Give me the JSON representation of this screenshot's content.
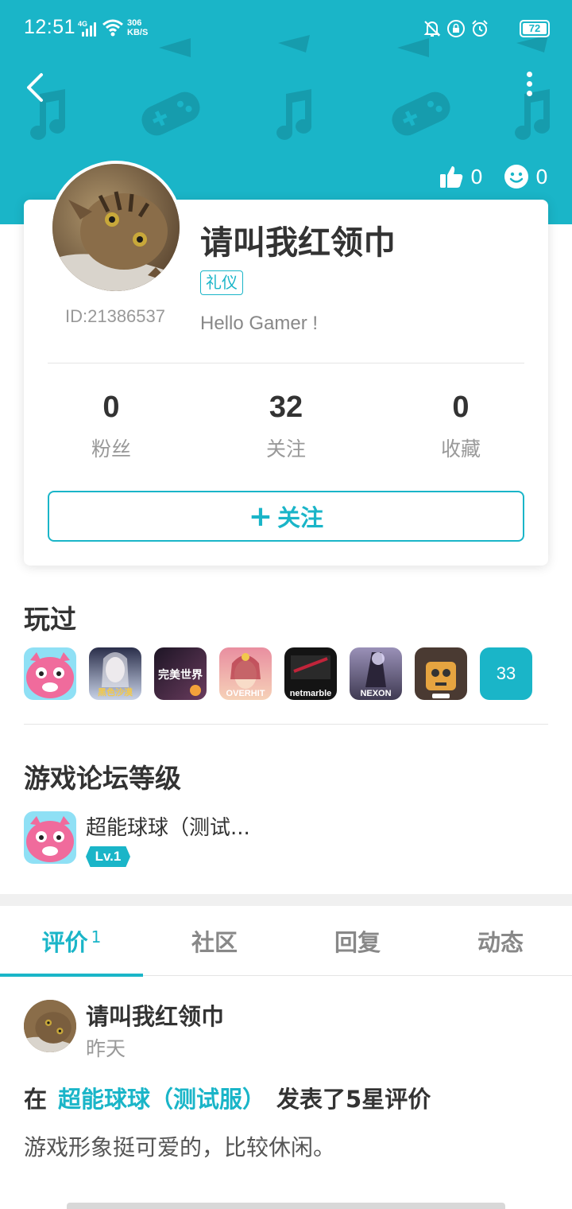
{
  "status_bar": {
    "time": "12:51",
    "network": "4G",
    "speed_value": "306",
    "speed_unit": "KB/S",
    "battery": "72"
  },
  "colors": {
    "accent": "#1ab5c8",
    "text": "#333333",
    "muted": "#999999"
  },
  "header": {
    "likes": "0",
    "smiles": "0"
  },
  "profile": {
    "username": "请叫我红领巾",
    "id_text": "ID:21386537",
    "badge": "礼仪",
    "bio": "Hello Gamer !",
    "stats": [
      {
        "value": "0",
        "label": "粉丝"
      },
      {
        "value": "32",
        "label": "关注"
      },
      {
        "value": "0",
        "label": "收藏"
      }
    ],
    "follow_label": "关注"
  },
  "played": {
    "title": "玩过",
    "games": [
      {
        "label": "",
        "color_a": "#f06b9c",
        "color_b": "#8fe0f5"
      },
      {
        "label": "黑色沙漠",
        "color_a": "#2a2e4a",
        "color_b": "#c9d3e8"
      },
      {
        "label": "完美世界",
        "color_a": "#1d1525",
        "color_b": "#6a3c5e"
      },
      {
        "label": "OVERHIT",
        "color_a": "#e98ea0",
        "color_b": "#f6d2b8"
      },
      {
        "label": "netmarble",
        "color_a": "#141414",
        "color_b": "#3a3a3a"
      },
      {
        "label": "NEXON",
        "color_a": "#3f3a52",
        "color_b": "#9a91b8"
      },
      {
        "label": "",
        "color_a": "#4a3a32",
        "color_b": "#e6a440"
      }
    ],
    "more_count": "33"
  },
  "forum": {
    "title": "游戏论坛等级",
    "game_name": "超能球球（测试...",
    "level": "Lv.1"
  },
  "tabs": [
    {
      "label": "评价",
      "count": "1"
    },
    {
      "label": "社区",
      "count": ""
    },
    {
      "label": "回复",
      "count": ""
    },
    {
      "label": "动态",
      "count": ""
    }
  ],
  "review": {
    "username": "请叫我红领巾",
    "time": "昨天",
    "prefix": "在",
    "game": "超能球球（测试服）",
    "suffix": "发表了5星评价",
    "body": "游戏形象挺可爱的，比较休闲。"
  }
}
